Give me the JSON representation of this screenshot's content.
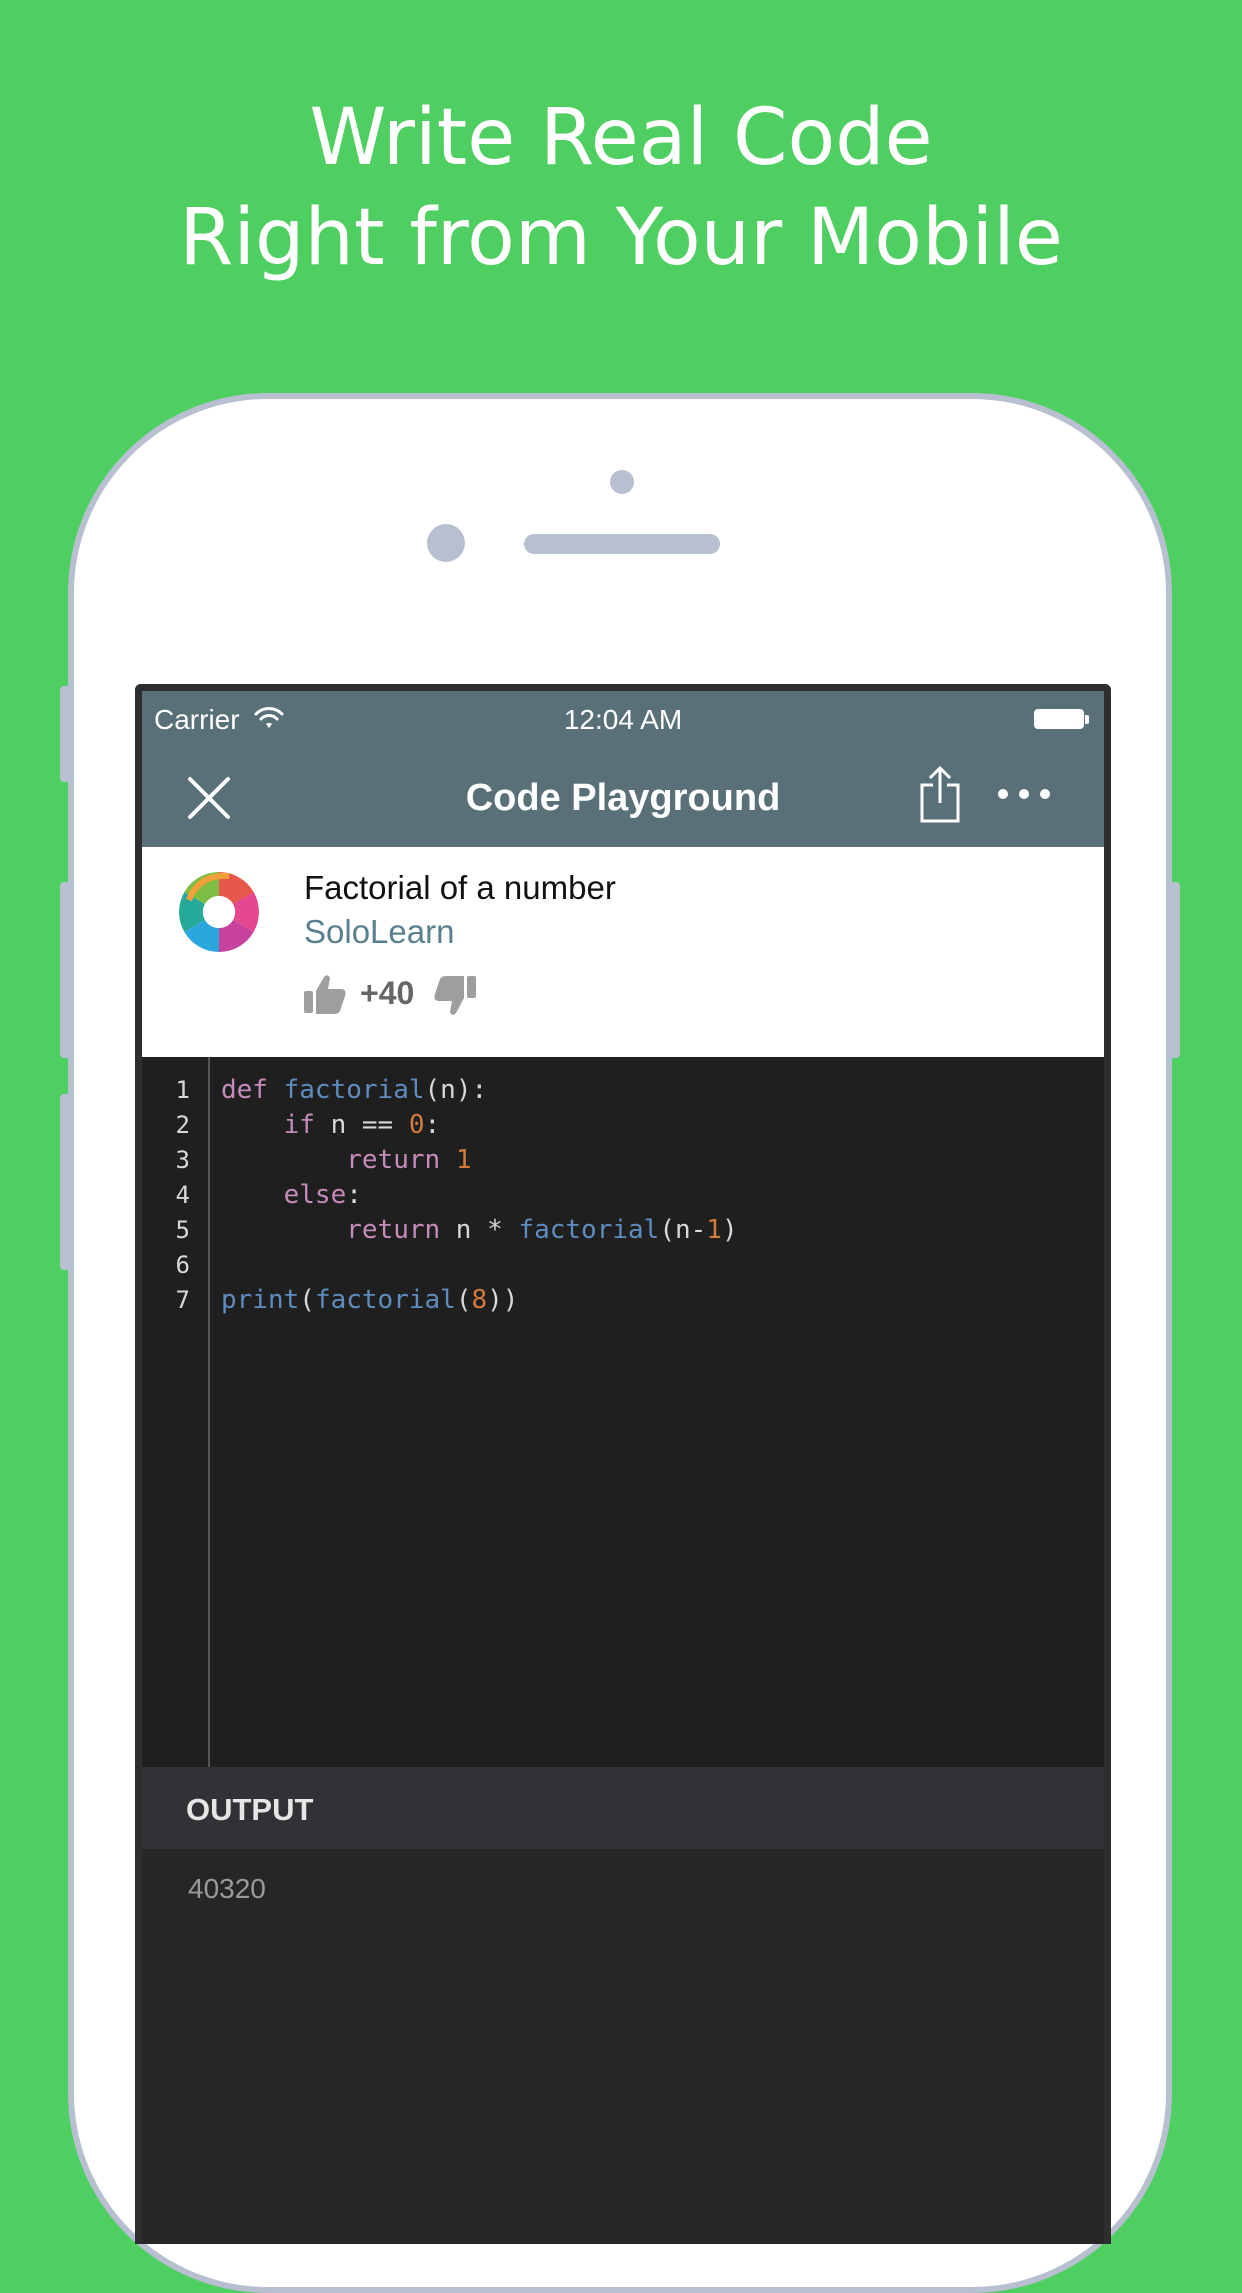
{
  "headline": {
    "line1": "Write Real Code",
    "line2": "Right from Your Mobile"
  },
  "status_bar": {
    "carrier": "Carrier",
    "time": "12:04 AM",
    "icons": [
      "wifi-icon",
      "battery-icon"
    ]
  },
  "nav": {
    "title": "Code Playground",
    "icons": [
      "close-icon",
      "share-icon",
      "more-icon"
    ]
  },
  "code_info": {
    "title": "Factorial of a number",
    "author": "SoloLearn",
    "votes": "+40",
    "icons": [
      "thumb-up-icon",
      "thumb-down-icon"
    ]
  },
  "editor": {
    "lines": [
      {
        "n": "1",
        "tokens": [
          [
            "kw",
            "def"
          ],
          [
            "pl",
            " "
          ],
          [
            "fn",
            "factorial"
          ],
          [
            "pl",
            "(n):"
          ]
        ]
      },
      {
        "n": "2",
        "tokens": [
          [
            "pl",
            "    "
          ],
          [
            "kw",
            "if"
          ],
          [
            "pl",
            " n == "
          ],
          [
            "num",
            "0"
          ],
          [
            "pl",
            ":"
          ]
        ]
      },
      {
        "n": "3",
        "tokens": [
          [
            "pl",
            "        "
          ],
          [
            "kw",
            "return"
          ],
          [
            "pl",
            " "
          ],
          [
            "num",
            "1"
          ]
        ]
      },
      {
        "n": "4",
        "tokens": [
          [
            "pl",
            "    "
          ],
          [
            "kw",
            "else"
          ],
          [
            "pl",
            ":"
          ]
        ]
      },
      {
        "n": "5",
        "tokens": [
          [
            "pl",
            "        "
          ],
          [
            "kw",
            "return"
          ],
          [
            "pl",
            " n * "
          ],
          [
            "fn",
            "factorial"
          ],
          [
            "pl",
            "(n-"
          ],
          [
            "num",
            "1"
          ],
          [
            "pl",
            ")"
          ]
        ]
      },
      {
        "n": "6",
        "tokens": []
      },
      {
        "n": "7",
        "tokens": [
          [
            "fn",
            "print"
          ],
          [
            "pl",
            "("
          ],
          [
            "fn",
            "factorial"
          ],
          [
            "pl",
            "("
          ],
          [
            "num",
            "8"
          ],
          [
            "pl",
            "))"
          ]
        ]
      }
    ]
  },
  "output": {
    "label": "OUTPUT",
    "value": "40320"
  },
  "colors": {
    "background": "#4fce62",
    "nav_bar": "#5a7079",
    "editor_bg": "#1f1f1f",
    "keyword": "#c58bba",
    "function": "#5f8cbf",
    "number": "#d27b3e",
    "author": "#5a7f8f"
  }
}
